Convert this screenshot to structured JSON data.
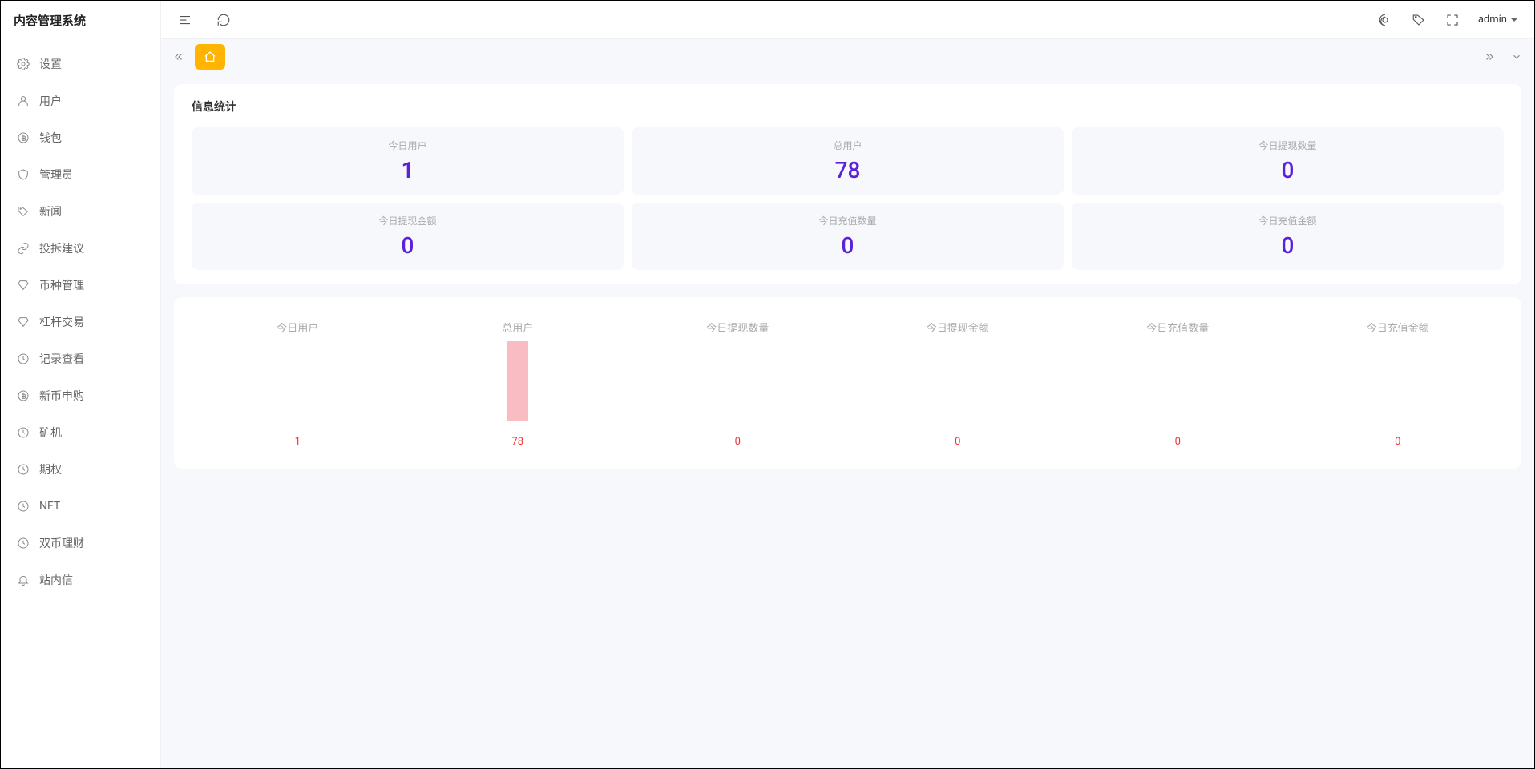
{
  "app": {
    "title": "内容管理系统"
  },
  "sidebar": {
    "items": [
      {
        "label": "设置"
      },
      {
        "label": "用户"
      },
      {
        "label": "钱包"
      },
      {
        "label": "管理员"
      },
      {
        "label": "新闻"
      },
      {
        "label": "投拆建议"
      },
      {
        "label": "币种管理"
      },
      {
        "label": "杠杆交易"
      },
      {
        "label": "记录查看"
      },
      {
        "label": "新币申购"
      },
      {
        "label": "矿机"
      },
      {
        "label": "期权"
      },
      {
        "label": "NFT"
      },
      {
        "label": "双币理财"
      },
      {
        "label": "站内信"
      }
    ]
  },
  "header": {
    "user": "admin"
  },
  "stats": {
    "title": "信息统计",
    "cells": [
      {
        "label": "今日用户",
        "value": "1"
      },
      {
        "label": "总用户",
        "value": "78"
      },
      {
        "label": "今日提现数量",
        "value": "0"
      },
      {
        "label": "今日提现金额",
        "value": "0"
      },
      {
        "label": "今日充值数量",
        "value": "0"
      },
      {
        "label": "今日充值金额",
        "value": "0"
      }
    ]
  },
  "chart_data": {
    "type": "bar",
    "categories": [
      "今日用户",
      "总用户",
      "今日提现数量",
      "今日提现金额",
      "今日充值数量",
      "今日充值金额"
    ],
    "values": [
      1,
      78,
      0,
      0,
      0,
      0
    ],
    "title": "",
    "xlabel": "",
    "ylabel": "",
    "ylim": [
      0,
      78
    ]
  }
}
